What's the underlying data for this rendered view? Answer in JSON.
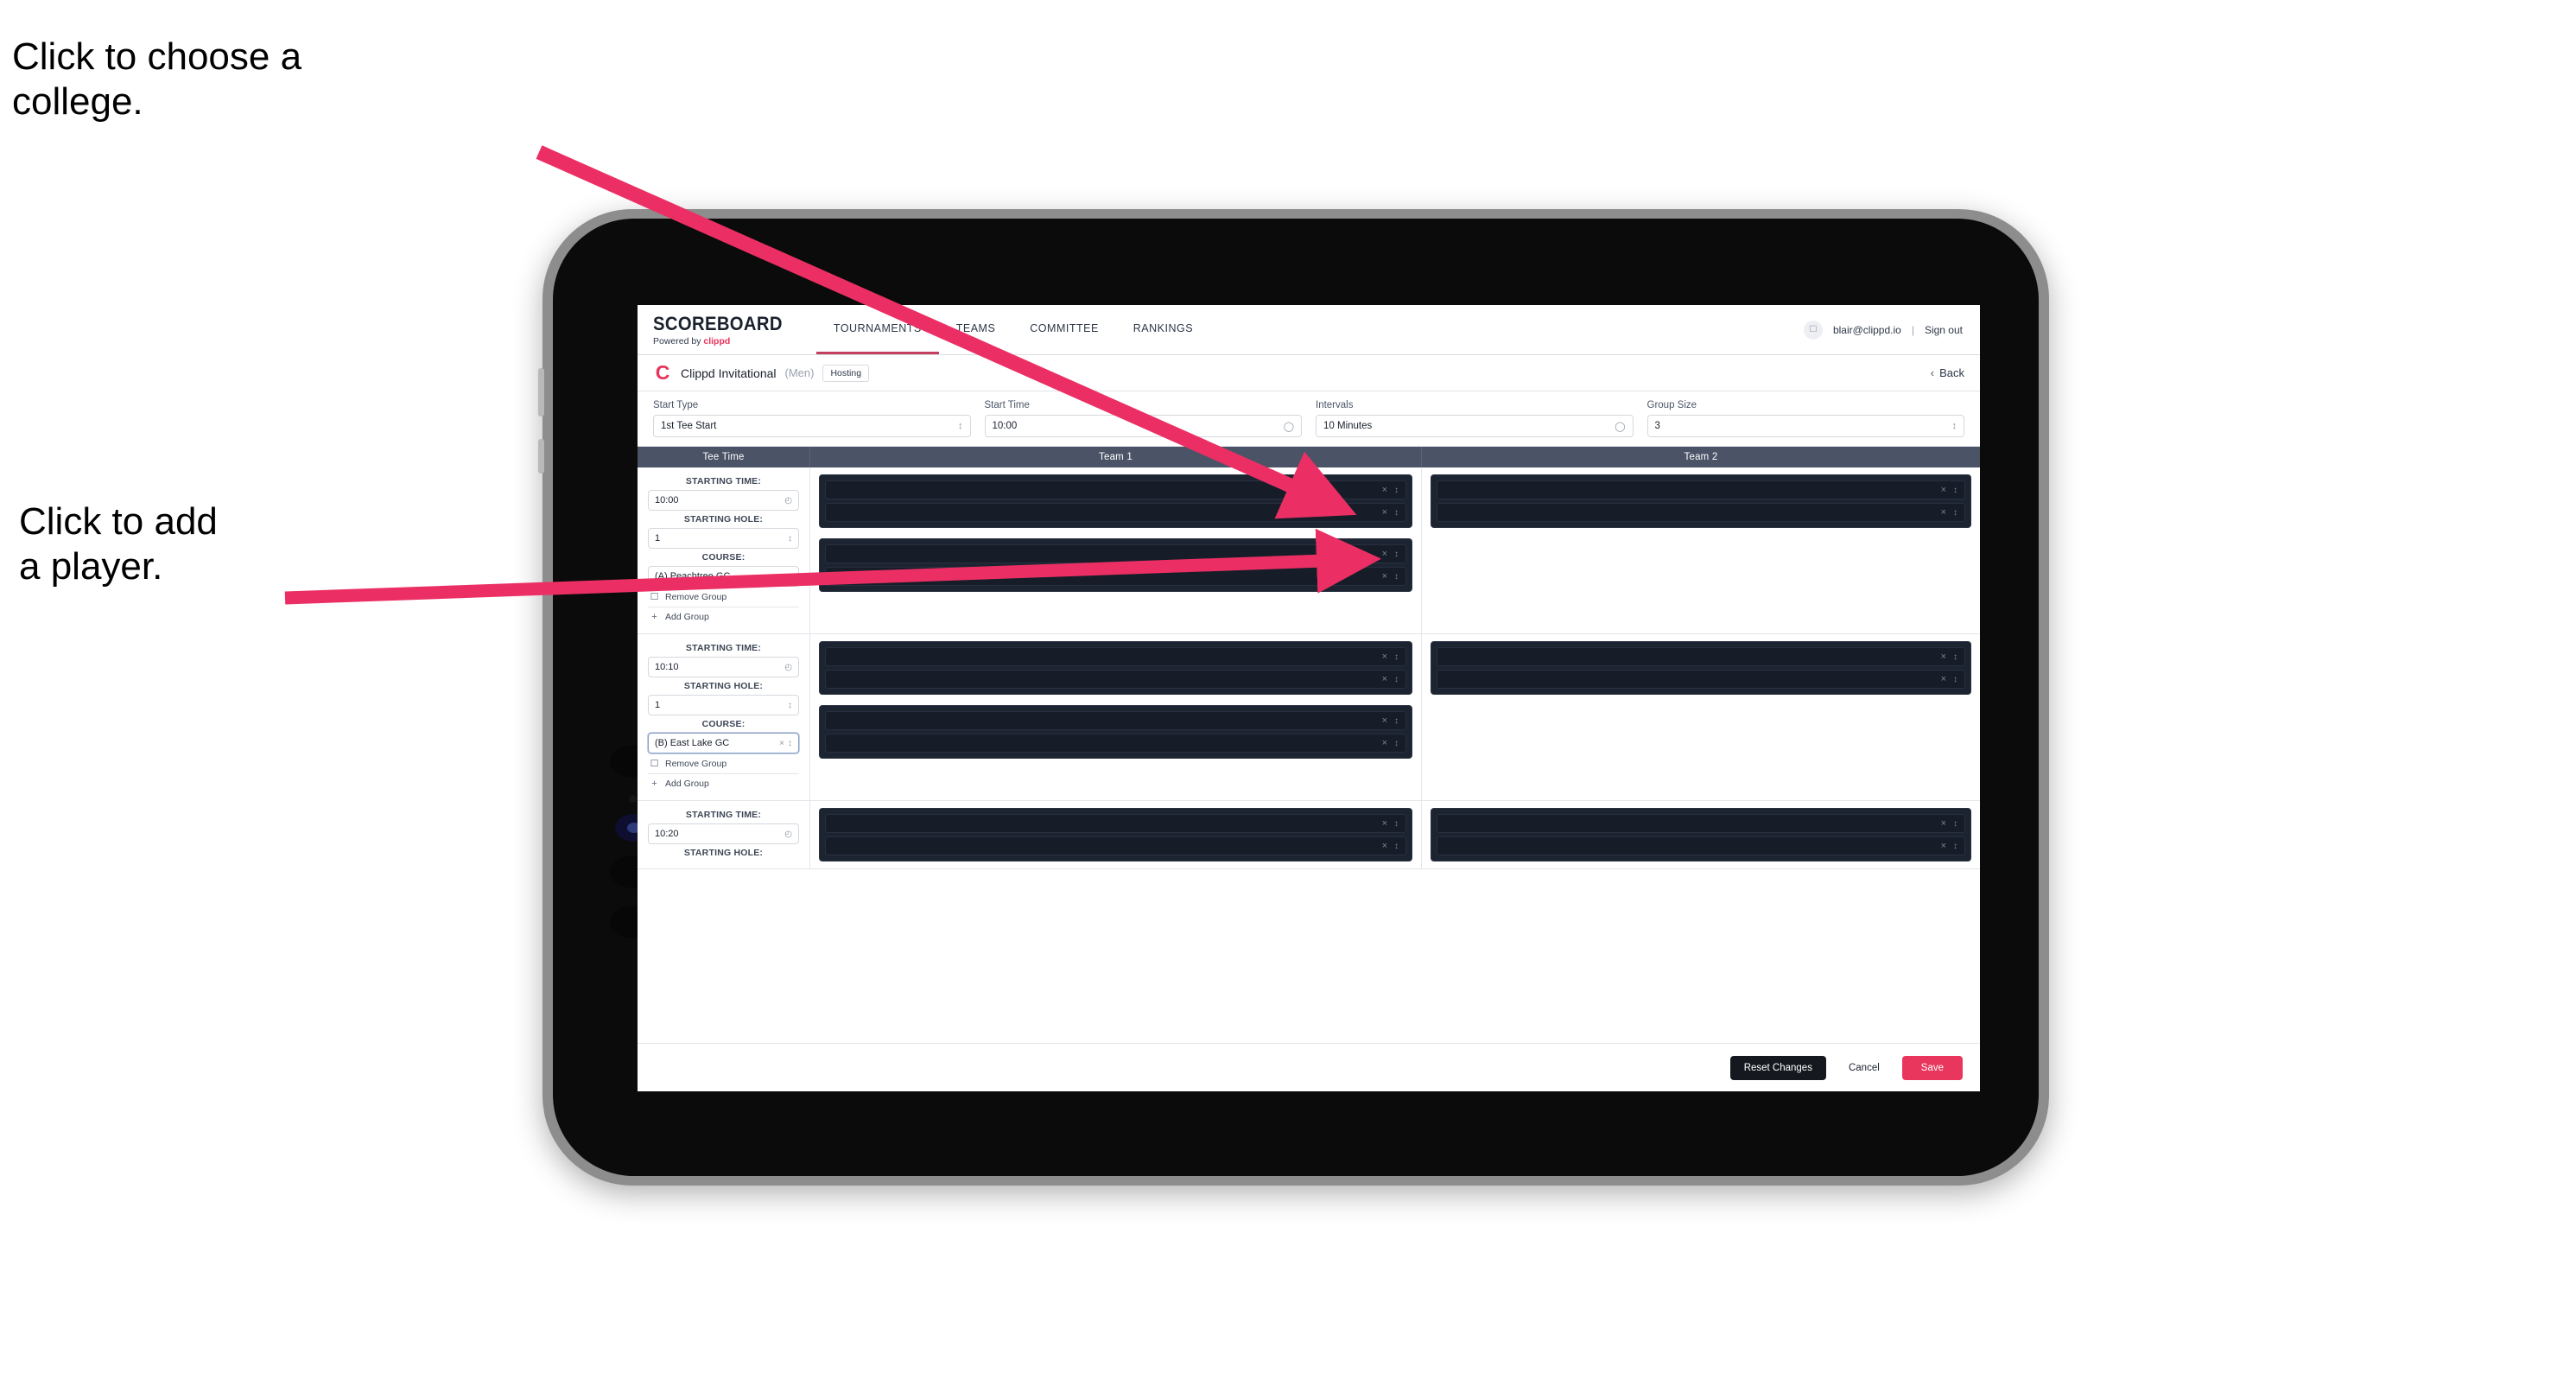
{
  "annotations": [
    {
      "id": "choose-college",
      "text": "Click to choose a\ncollege."
    },
    {
      "id": "add-player",
      "text": "Click to add\na player."
    }
  ],
  "colors": {
    "accent_pink": "#e8365c",
    "annotation_arrow": "#eb2f64",
    "table_header": "#4b5367",
    "slot_dark": "#1d2431",
    "nav_active_underline": "#c5405f"
  },
  "app": {
    "topnav": {
      "brand": {
        "title": "SCOREBOARD",
        "powered_prefix": "Powered by ",
        "powered_brand": "clippd"
      },
      "tabs": [
        {
          "label": "TOURNAMENTS",
          "active": true
        },
        {
          "label": "TEAMS",
          "active": false
        },
        {
          "label": "COMMITTEE",
          "active": false
        },
        {
          "label": "RANKINGS",
          "active": false
        }
      ],
      "account": {
        "avatar_icon": "user-avatar-icon",
        "email": "blair@clippd.io",
        "separator": "|",
        "sign_out": "Sign out"
      }
    },
    "tournament_bar": {
      "logo_glyph": "C",
      "name": "Clippd Invitational",
      "gender": "(Men)",
      "badge": "Hosting",
      "back_label": "Back",
      "back_chevron": "‹"
    },
    "controls": [
      {
        "label": "Start Type",
        "value": "1st Tee Start",
        "icon": "stepper-icon"
      },
      {
        "label": "Start Time",
        "value": "10:00",
        "icon": "clock-icon"
      },
      {
        "label": "Intervals",
        "value": "10 Minutes",
        "icon": "clock-icon"
      },
      {
        "label": "Group Size",
        "value": "3",
        "icon": "stepper-icon"
      }
    ],
    "table": {
      "headers": [
        "Tee Time",
        "Team 1",
        "Team 2"
      ],
      "field_labels": {
        "time": "STARTING TIME:",
        "hole": "STARTING HOLE:",
        "course": "COURSE:"
      },
      "group_actions": {
        "remove": "Remove Group",
        "add": "Add Group",
        "remove_icon": "trash-icon",
        "add_icon": "plus-icon"
      },
      "rows": [
        {
          "tee": {
            "time": "10:00",
            "hole": "1",
            "course": "(A) Peachtree GC",
            "course_focused": false,
            "course_clear_icon": "×"
          },
          "team1_groups": [
            {
              "slots": [
                {
                  "name": ""
                },
                {
                  "name": ""
                }
              ]
            },
            {
              "slots": [
                {
                  "name": ""
                },
                {
                  "name": ""
                }
              ]
            }
          ],
          "team2_groups": [
            {
              "slots": [
                {
                  "name": ""
                },
                {
                  "name": ""
                }
              ]
            }
          ]
        },
        {
          "tee": {
            "time": "10:10",
            "hole": "1",
            "course": "(B) East Lake GC",
            "course_focused": true,
            "course_clear_icon": "×"
          },
          "team1_groups": [
            {
              "slots": [
                {
                  "name": ""
                },
                {
                  "name": ""
                }
              ]
            },
            {
              "slots": [
                {
                  "name": ""
                },
                {
                  "name": ""
                }
              ]
            }
          ],
          "team2_groups": [
            {
              "slots": [
                {
                  "name": ""
                },
                {
                  "name": ""
                }
              ]
            }
          ]
        },
        {
          "tee": {
            "time": "10:20",
            "hole": "",
            "course": "",
            "course_focused": false,
            "course_clear_icon": "×"
          },
          "team1_groups": [
            {
              "slots": [
                {
                  "name": ""
                },
                {
                  "name": ""
                }
              ]
            }
          ],
          "team2_groups": [
            {
              "slots": [
                {
                  "name": ""
                },
                {
                  "name": ""
                }
              ]
            }
          ]
        }
      ]
    },
    "footer": {
      "reset": "Reset Changes",
      "cancel": "Cancel",
      "save": "Save"
    }
  }
}
